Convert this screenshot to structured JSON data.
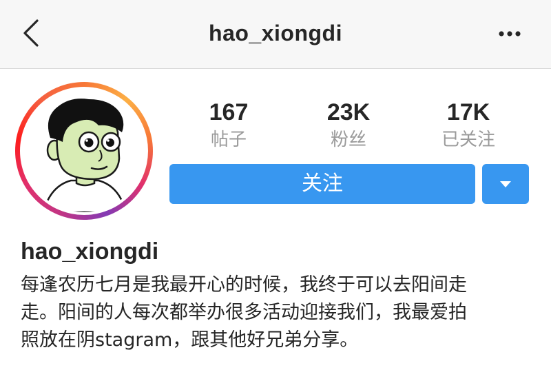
{
  "header": {
    "title": "hao_xiongdi",
    "back_icon": "chevron-left-icon",
    "more_icon": "more-horizontal-icon"
  },
  "profile": {
    "avatar": "cartoon-character-avatar",
    "username": "hao_xiongdi",
    "bio_lines": [
      "每逢农历七月是我最开心的时候，我终于可以去阳间走",
      "走。阳间的人每次都举办很多活动迎接我们，我最爱拍",
      "照放在阴stagram，跟其他好兄弟分享。"
    ]
  },
  "stats": {
    "posts": {
      "count": "167",
      "label": "帖子"
    },
    "followers": {
      "count": "23K",
      "label": "粉丝"
    },
    "following": {
      "count": "17K",
      "label": "已关注"
    }
  },
  "actions": {
    "follow_label": "关注",
    "dropdown_icon": "caret-down-icon"
  },
  "colors": {
    "accent": "#3897f0",
    "text": "#262626",
    "muted": "#9a9a9a",
    "header_bg": "#f7f7f7"
  }
}
